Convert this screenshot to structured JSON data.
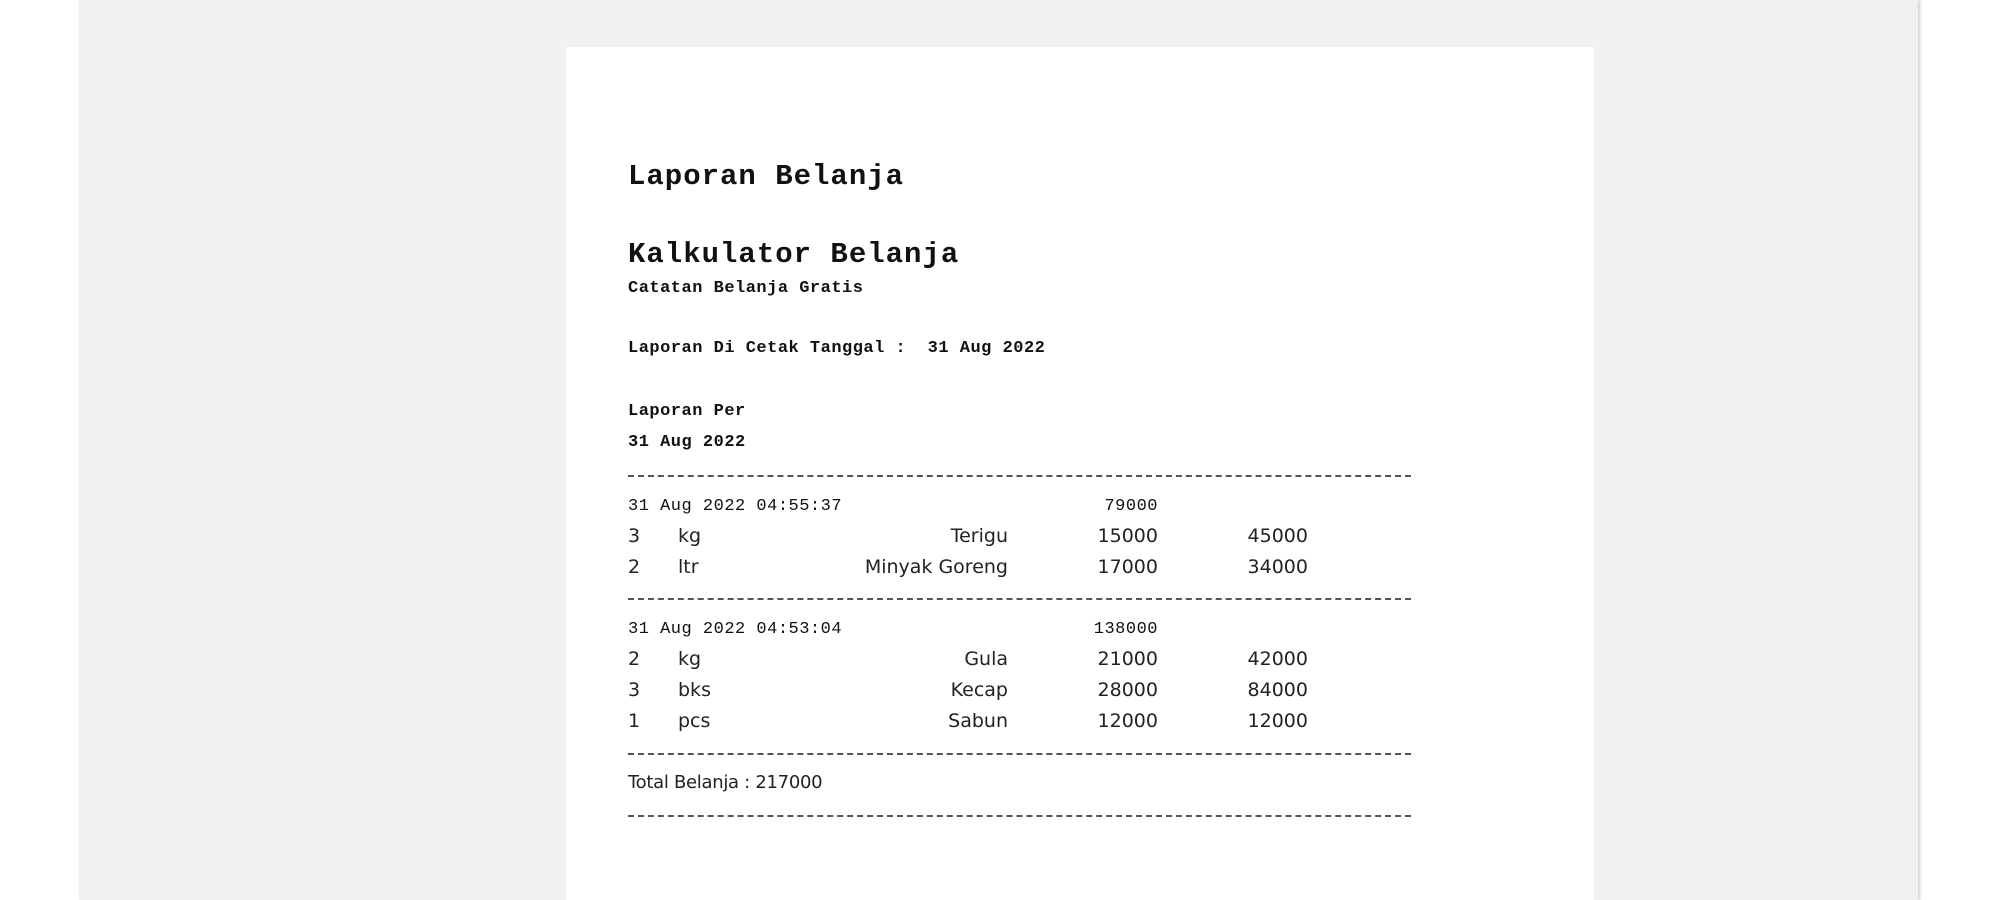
{
  "report": {
    "title": "Laporan Belanja",
    "app_name": "Kalkulator Belanja",
    "tagline": "Catatan Belanja Gratis",
    "printed_label": "Laporan Di Cetak Tanggal :",
    "printed_date": "31 Aug 2022",
    "period_label": "Laporan Per",
    "period_date": "31 Aug 2022"
  },
  "transactions": [
    {
      "datetime": "31 Aug 2022 04:55:37",
      "total": "79000",
      "items": [
        {
          "qty": "3",
          "unit": "kg",
          "name": "Terigu",
          "price": "15000",
          "subtotal": "45000"
        },
        {
          "qty": "2",
          "unit": "ltr",
          "name": "Minyak Goreng",
          "price": "17000",
          "subtotal": "34000"
        }
      ]
    },
    {
      "datetime": "31 Aug 2022 04:53:04",
      "total": "138000",
      "items": [
        {
          "qty": "2",
          "unit": "kg",
          "name": "Gula",
          "price": "21000",
          "subtotal": "42000"
        },
        {
          "qty": "3",
          "unit": "bks",
          "name": "Kecap",
          "price": "28000",
          "subtotal": "84000"
        },
        {
          "qty": "1",
          "unit": "pcs",
          "name": "Sabun",
          "price": "12000",
          "subtotal": "12000"
        }
      ]
    }
  ],
  "summary": {
    "grand_total": "Total Belanja : 217000"
  }
}
